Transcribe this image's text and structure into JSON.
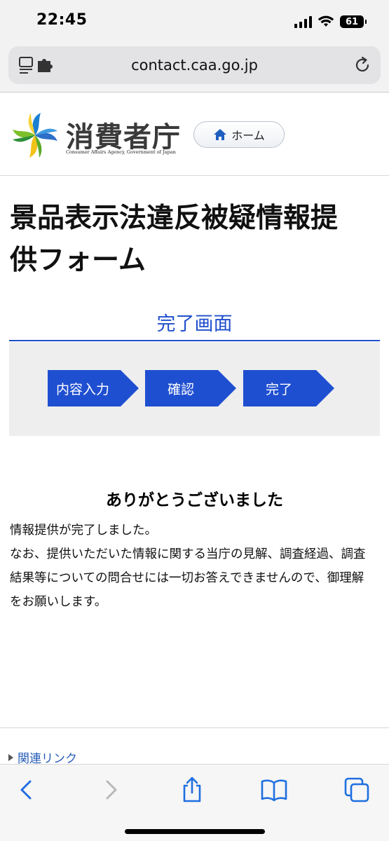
{
  "status_bar": {
    "time": "22:45",
    "battery": "61"
  },
  "browser": {
    "url": "contact.caa.go.jp"
  },
  "header": {
    "logo_title": "消費者庁",
    "logo_subtitle": "Consumer Affairs Agency, Government of Japan",
    "home_button": "ホーム"
  },
  "page": {
    "title_line1": "景品表示法違反被疑情報提",
    "title_line2": "供フォーム",
    "section_title": "完了画面",
    "steps": [
      "内容入力",
      "確認",
      "完了"
    ],
    "thanks_heading": "ありがとうございました",
    "body_line1": "情報提供が完了しました。",
    "body_line2": "なお、提供いただいた情報に関する当庁の見解、調査経過、調査結果等についての問合せには一切お答えできませんので、御理解をお願いします。"
  },
  "footer": {
    "related_links": "関連リンク"
  },
  "colors": {
    "accent_blue": "#1f4fd1",
    "link_blue": "#2a5fb8"
  },
  "icons": {
    "toolbar": [
      "back-icon",
      "forward-icon",
      "share-icon",
      "bookmarks-icon",
      "tabs-icon"
    ]
  }
}
